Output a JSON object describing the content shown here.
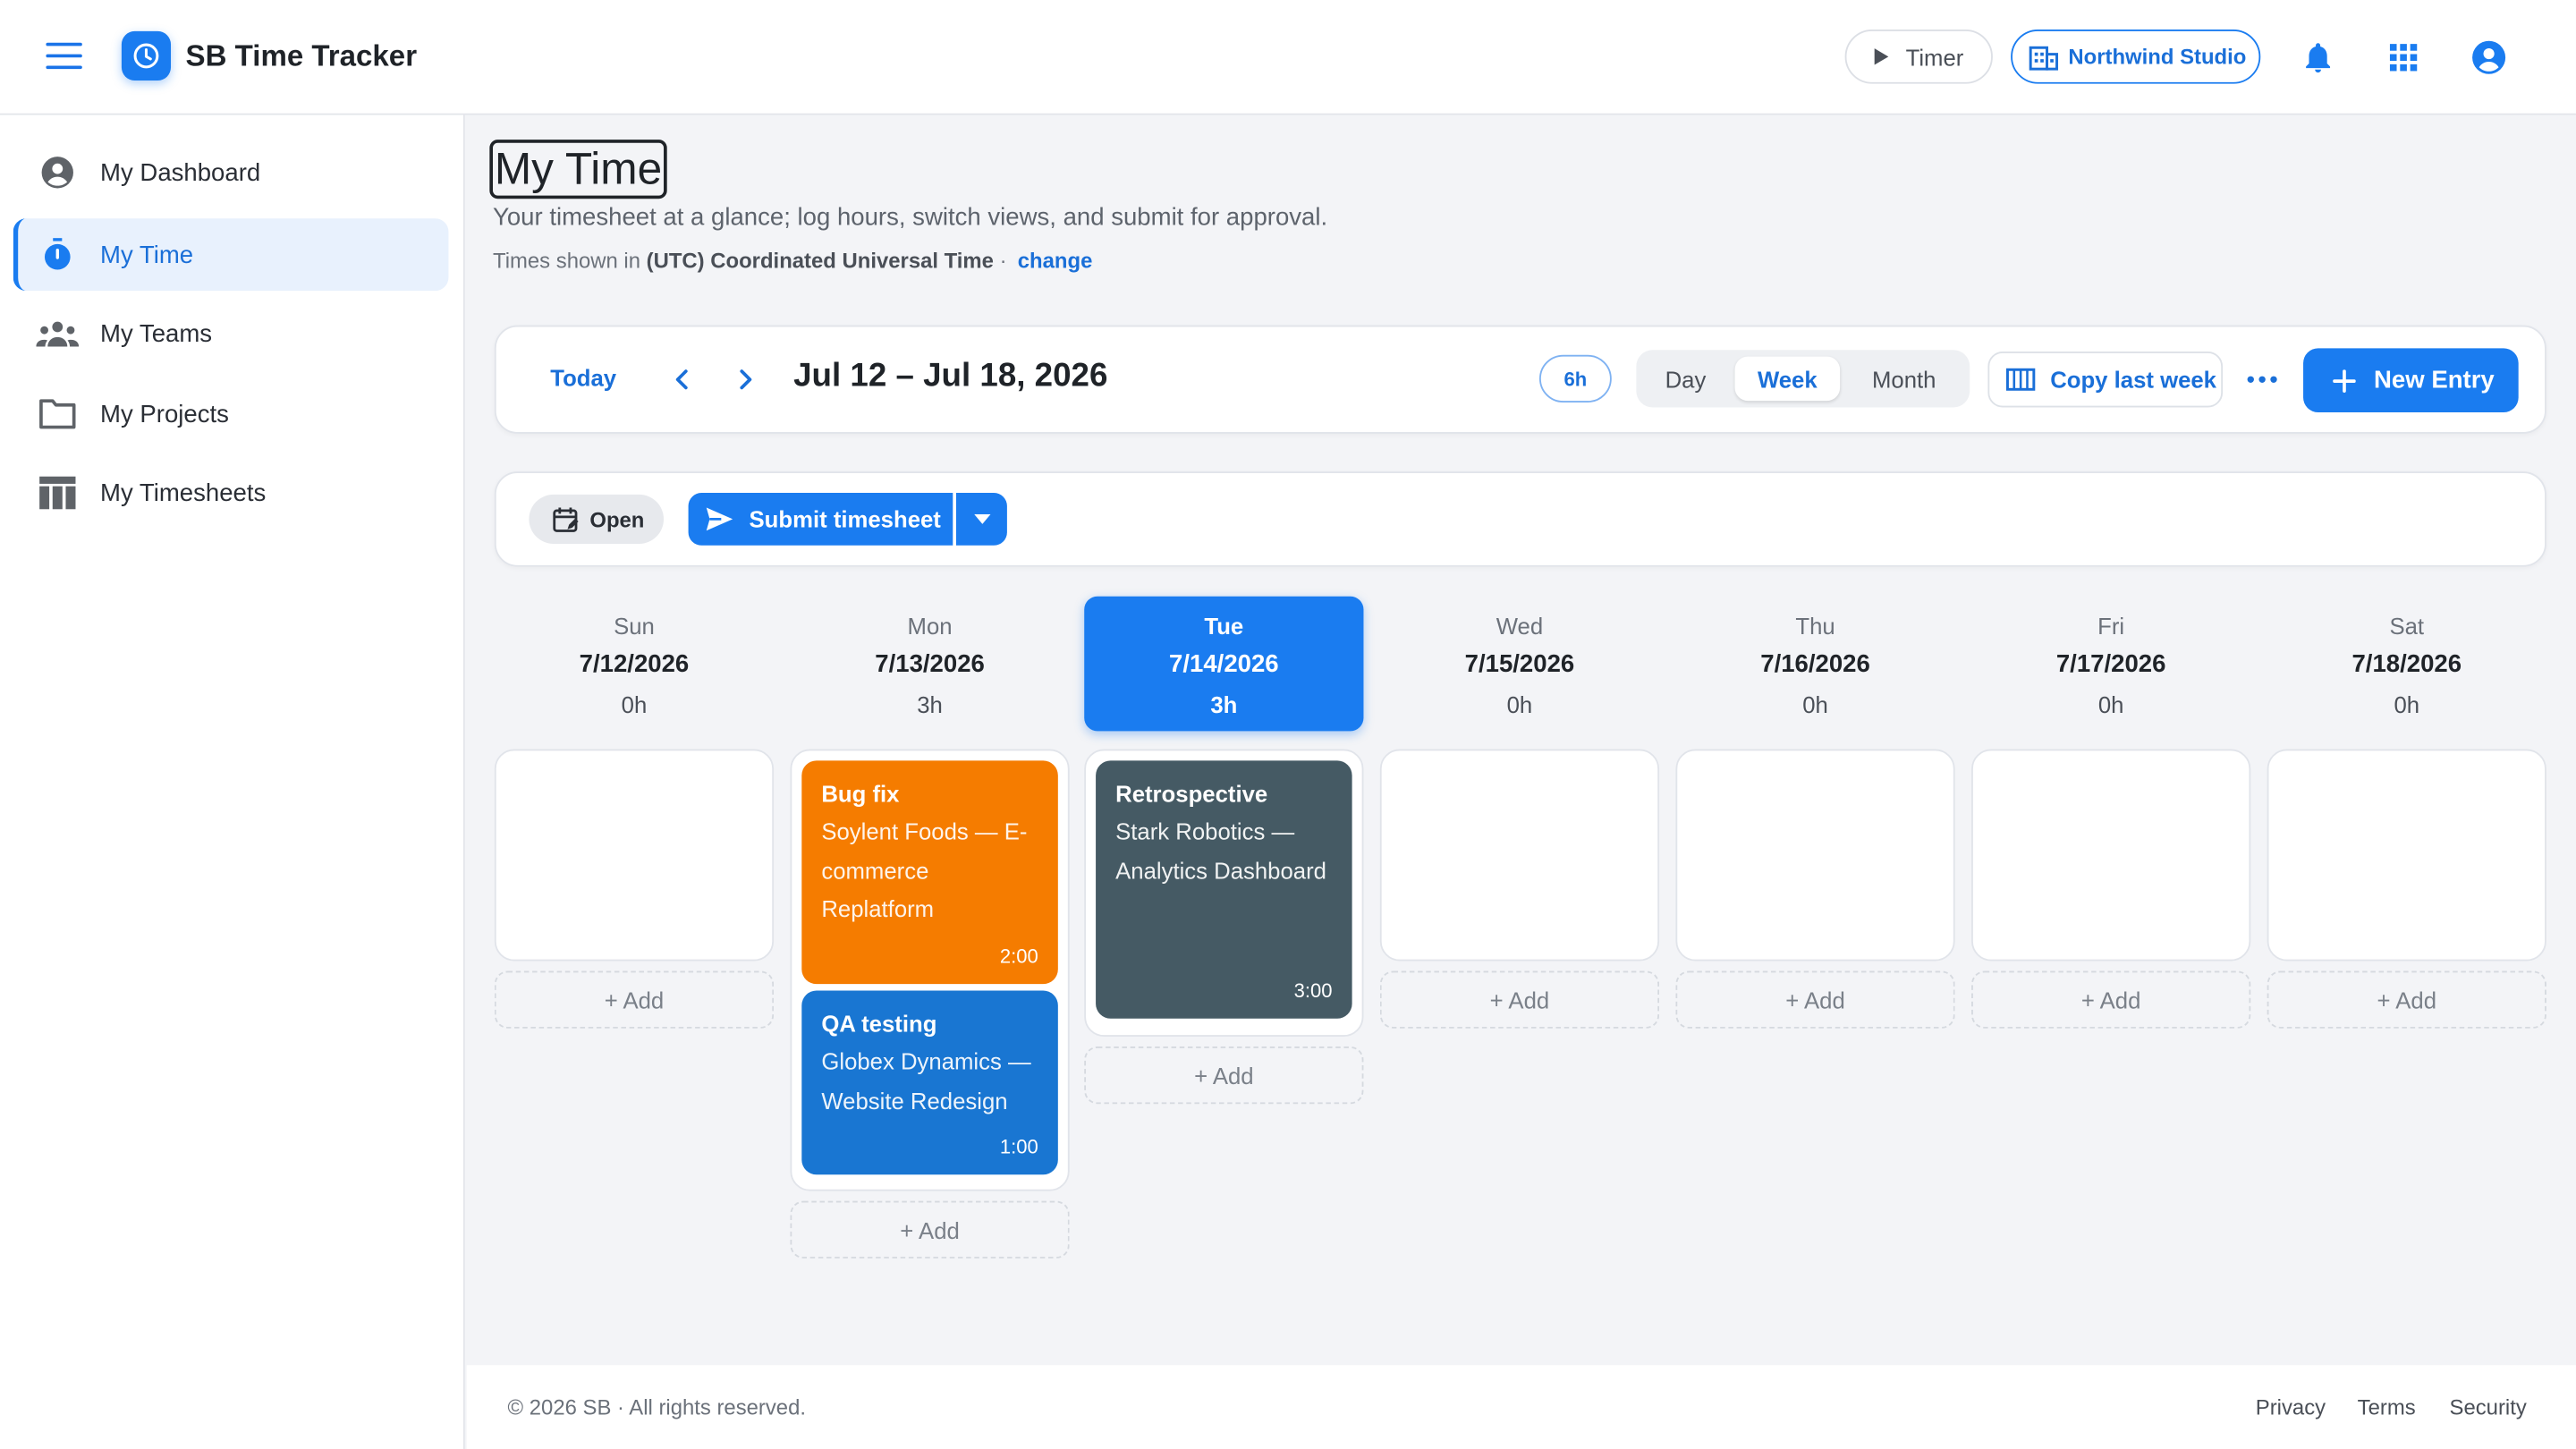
{
  "app": {
    "title": "SB Time Tracker"
  },
  "header": {
    "timer_label": "Timer",
    "org_label": "Northwind Studio"
  },
  "sidebar": {
    "items": [
      {
        "label": "My Dashboard",
        "icon": "account-circle-icon"
      },
      {
        "label": "My Time",
        "icon": "stopwatch-icon",
        "active": true
      },
      {
        "label": "My Teams",
        "icon": "group-icon"
      },
      {
        "label": "My Projects",
        "icon": "folder-icon"
      },
      {
        "label": "My Timesheets",
        "icon": "table-icon"
      }
    ]
  },
  "page": {
    "title": "My Time",
    "subtitle": "Your timesheet at a glance; log hours, switch views, and submit for approval.",
    "tz_prefix": "Times shown in",
    "tz_name": "(UTC) Coordinated Universal Time",
    "tz_sep": "·",
    "tz_change": "change"
  },
  "toolbar": {
    "today_label": "Today",
    "range": "Jul 12 – Jul 18, 2026",
    "total_hours": "6h",
    "views": [
      "Day",
      "Week",
      "Month"
    ],
    "selected_view": "Week",
    "copy_label": "Copy last week",
    "new_entry_label": "New Entry"
  },
  "status": {
    "state_label": "Open",
    "submit_label": "Submit timesheet"
  },
  "week": [
    {
      "name": "Sun",
      "date": "7/12/2026",
      "hours": "0h",
      "add": "+ Add",
      "entries": []
    },
    {
      "name": "Mon",
      "date": "7/13/2026",
      "hours": "3h",
      "add": "+ Add",
      "entries": [
        {
          "title": "Bug fix",
          "project": "Soylent Foods — E-commerce Replatform",
          "duration": "2:00",
          "color": "#f57c00"
        },
        {
          "title": "QA testing",
          "project": "Globex Dynamics — Website Redesign",
          "duration": "1:00",
          "color": "#1976d2"
        }
      ]
    },
    {
      "name": "Tue",
      "date": "7/14/2026",
      "hours": "3h",
      "add": "+ Add",
      "today": true,
      "entries": [
        {
          "title": "Retrospective",
          "project": "Stark Robotics — Analytics Dashboard",
          "duration": "3:00",
          "color": "#455a64"
        }
      ]
    },
    {
      "name": "Wed",
      "date": "7/15/2026",
      "hours": "0h",
      "add": "+ Add",
      "entries": []
    },
    {
      "name": "Thu",
      "date": "7/16/2026",
      "hours": "0h",
      "add": "+ Add",
      "entries": []
    },
    {
      "name": "Fri",
      "date": "7/17/2026",
      "hours": "0h",
      "add": "+ Add",
      "entries": []
    },
    {
      "name": "Sat",
      "date": "7/18/2026",
      "hours": "0h",
      "add": "+ Add",
      "entries": []
    }
  ],
  "footer": {
    "copyright": "© 2026 SB · All rights reserved.",
    "links": [
      "Privacy",
      "Terms",
      "Security"
    ]
  },
  "colors": {
    "accent": "#1a7cf0",
    "today": "#1a7cf0"
  }
}
